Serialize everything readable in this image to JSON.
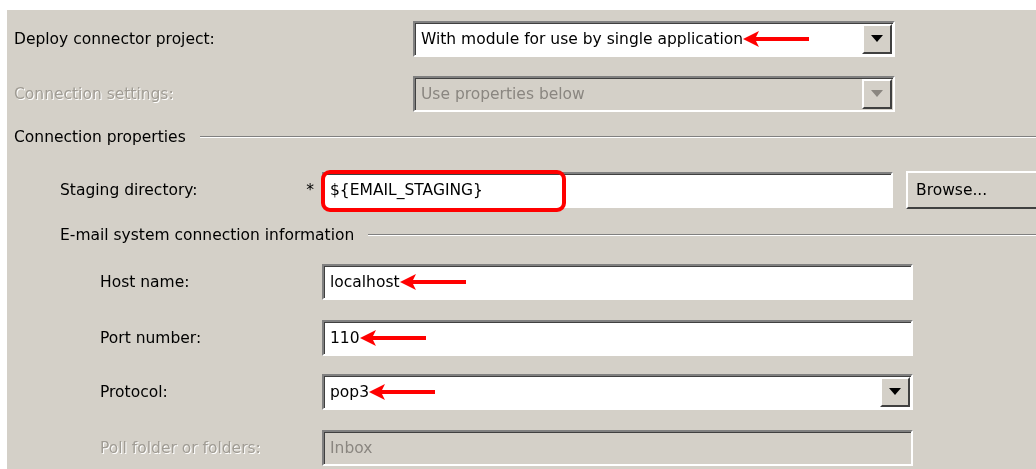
{
  "rows": [
    {
      "kind": "combo",
      "label": "Deploy connector project:",
      "value": "With module for use by single application",
      "disabled": false,
      "arrow": true
    },
    {
      "kind": "combo",
      "label": "Connection settings:",
      "value": "Use properties below",
      "disabled": true,
      "arrow": false
    }
  ],
  "group": {
    "title": "Connection properties",
    "fields": [
      {
        "kind": "text",
        "label": "Staging directory:",
        "marker": "*",
        "value": "${EMAIL_STAGING}",
        "highlighted": true,
        "arrow": false,
        "disabled": false,
        "button": "Browse..."
      }
    ],
    "subgroup": {
      "title": "E-mail system connection information",
      "fields": [
        {
          "kind": "text",
          "label": "Host name:",
          "value": "localhost",
          "highlighted": false,
          "arrow": true,
          "disabled": false
        },
        {
          "kind": "text",
          "label": "Port number:",
          "value": "110",
          "highlighted": false,
          "arrow": true,
          "disabled": false
        },
        {
          "kind": "combo",
          "label": "Protocol:",
          "value": "pop3",
          "highlighted": false,
          "arrow": true,
          "disabled": false
        },
        {
          "kind": "text",
          "label": "Poll folder or folders:",
          "value": "Inbox",
          "highlighted": false,
          "arrow": false,
          "disabled": true
        }
      ]
    }
  }
}
